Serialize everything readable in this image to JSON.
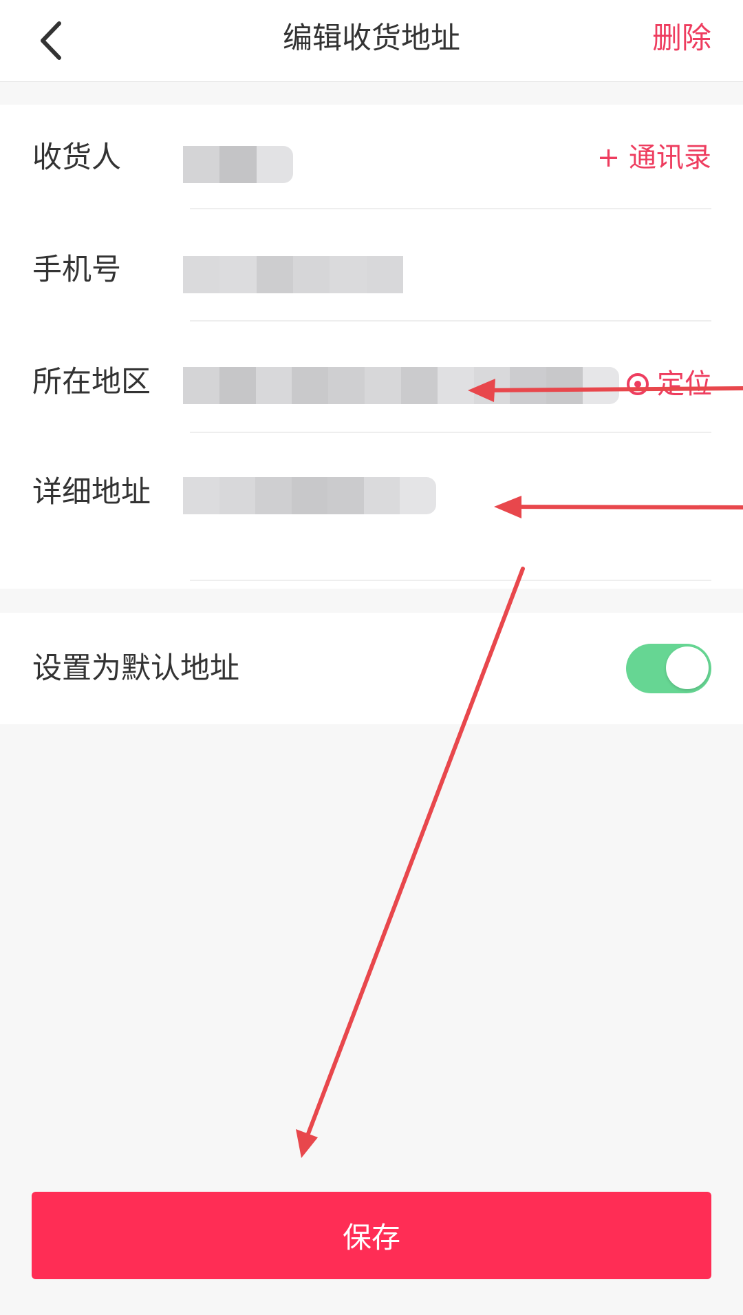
{
  "colors": {
    "accent": "#ee3d5f",
    "toggle_on": "#66d693",
    "save_button": "#ff2d55",
    "annotation_arrow": "#e8474c"
  },
  "header": {
    "back_icon": "chevron-left-icon",
    "title": "编辑收货地址",
    "delete_label": "删除"
  },
  "form": {
    "recipient_label": "收货人",
    "contacts_label": "+ 通讯录",
    "phone_label": "手机号",
    "region_label": "所在地区",
    "locate_icon": "target-icon",
    "locate_label": "定位",
    "detail_label": "详细地址"
  },
  "default_address": {
    "label": "设置为默认地址",
    "enabled": true
  },
  "save_label": "保存"
}
